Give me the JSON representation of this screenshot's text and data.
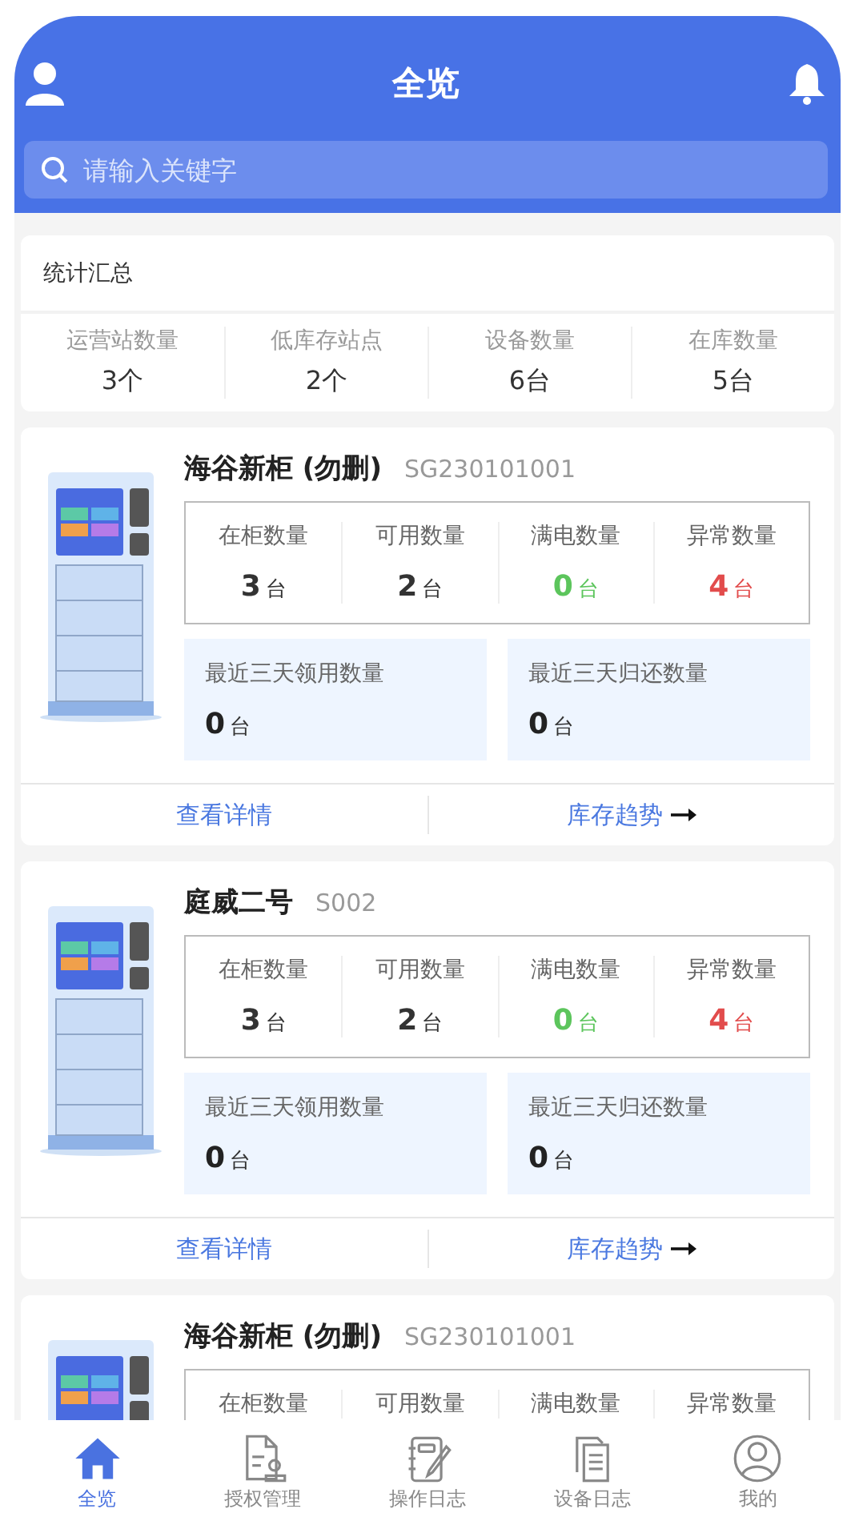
{
  "header": {
    "title": "全览"
  },
  "search": {
    "placeholder": "请输入关键字"
  },
  "summary": {
    "title": "统计汇总",
    "stats": [
      {
        "label": "运营站数量",
        "value": "3个"
      },
      {
        "label": "低库存站点",
        "value": "2个"
      },
      {
        "label": "设备数量",
        "value": "6台"
      },
      {
        "label": "在库数量",
        "value": "5台"
      }
    ]
  },
  "cabinets": [
    {
      "name": "海谷新柜 (勿删)",
      "code": "SG230101001",
      "stats": [
        {
          "label": "在柜数量",
          "value": "3",
          "unit": "台",
          "color": "#333333"
        },
        {
          "label": "可用数量",
          "value": "2",
          "unit": "台",
          "color": "#333333"
        },
        {
          "label": "满电数量",
          "value": "0",
          "unit": "台",
          "color": "#5cc55c"
        },
        {
          "label": "异常数量",
          "value": "4",
          "unit": "台",
          "color": "#e24c4c"
        }
      ],
      "recent": [
        {
          "label": "最近三天领用数量",
          "value": "0",
          "unit": "台"
        },
        {
          "label": "最近三天归还数量",
          "value": "0",
          "unit": "台"
        }
      ],
      "actions": [
        {
          "label": "查看详情",
          "arrow": false
        },
        {
          "label": "库存趋势",
          "arrow": true
        }
      ]
    },
    {
      "name": "庭威二号",
      "code": "S002",
      "stats": [
        {
          "label": "在柜数量",
          "value": "3",
          "unit": "台",
          "color": "#333333"
        },
        {
          "label": "可用数量",
          "value": "2",
          "unit": "台",
          "color": "#333333"
        },
        {
          "label": "满电数量",
          "value": "0",
          "unit": "台",
          "color": "#5cc55c"
        },
        {
          "label": "异常数量",
          "value": "4",
          "unit": "台",
          "color": "#e24c4c"
        }
      ],
      "recent": [
        {
          "label": "最近三天领用数量",
          "value": "0",
          "unit": "台"
        },
        {
          "label": "最近三天归还数量",
          "value": "0",
          "unit": "台"
        }
      ],
      "actions": [
        {
          "label": "查看详情",
          "arrow": false
        },
        {
          "label": "库存趋势",
          "arrow": true
        }
      ]
    },
    {
      "name": "海谷新柜 (勿删)",
      "code": "SG230101001",
      "stats": [
        {
          "label": "在柜数量"
        },
        {
          "label": "可用数量"
        },
        {
          "label": "满电数量"
        },
        {
          "label": "异常数量"
        }
      ]
    }
  ],
  "tabs": [
    {
      "label": "全览",
      "kind": "home",
      "selected": true
    },
    {
      "label": "授权管理",
      "kind": "auth",
      "selected": false
    },
    {
      "label": "操作日志",
      "kind": "notebook",
      "selected": false
    },
    {
      "label": "设备日志",
      "kind": "documents",
      "selected": false
    },
    {
      "label": "我的",
      "kind": "profile",
      "selected": false
    }
  ]
}
